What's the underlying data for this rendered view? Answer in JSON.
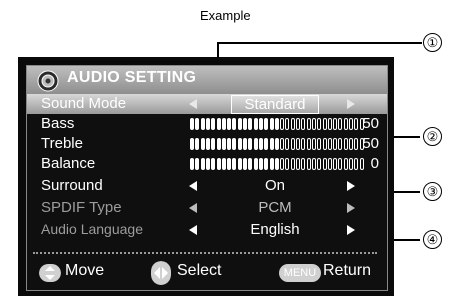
{
  "caption": "Example",
  "callouts": [
    "①",
    "②",
    "③",
    "④"
  ],
  "title": "AUDIO SETTING",
  "rows": [
    {
      "label": "Sound Mode",
      "value": "Standard"
    },
    {
      "label": "Bass",
      "value": "50",
      "level": 0.5
    },
    {
      "label": "Treble",
      "value": "50",
      "level": 0.5
    },
    {
      "label": "Balance",
      "value": "0",
      "level": 0.5
    },
    {
      "label": "Surround",
      "value": "On"
    },
    {
      "label": "SPDIF Type",
      "value": "PCM"
    },
    {
      "label": "Audio Language",
      "value": "English"
    }
  ],
  "footer": {
    "move": "Move",
    "select": "Select",
    "menu": "MENU",
    "return": "Return"
  },
  "colors": {
    "panel": "#0f0f0f",
    "title_bar": "#a6a6a6",
    "highlight": "#c0c0c0",
    "text": "#ffffff",
    "dim_text": "#9c9c9c"
  }
}
